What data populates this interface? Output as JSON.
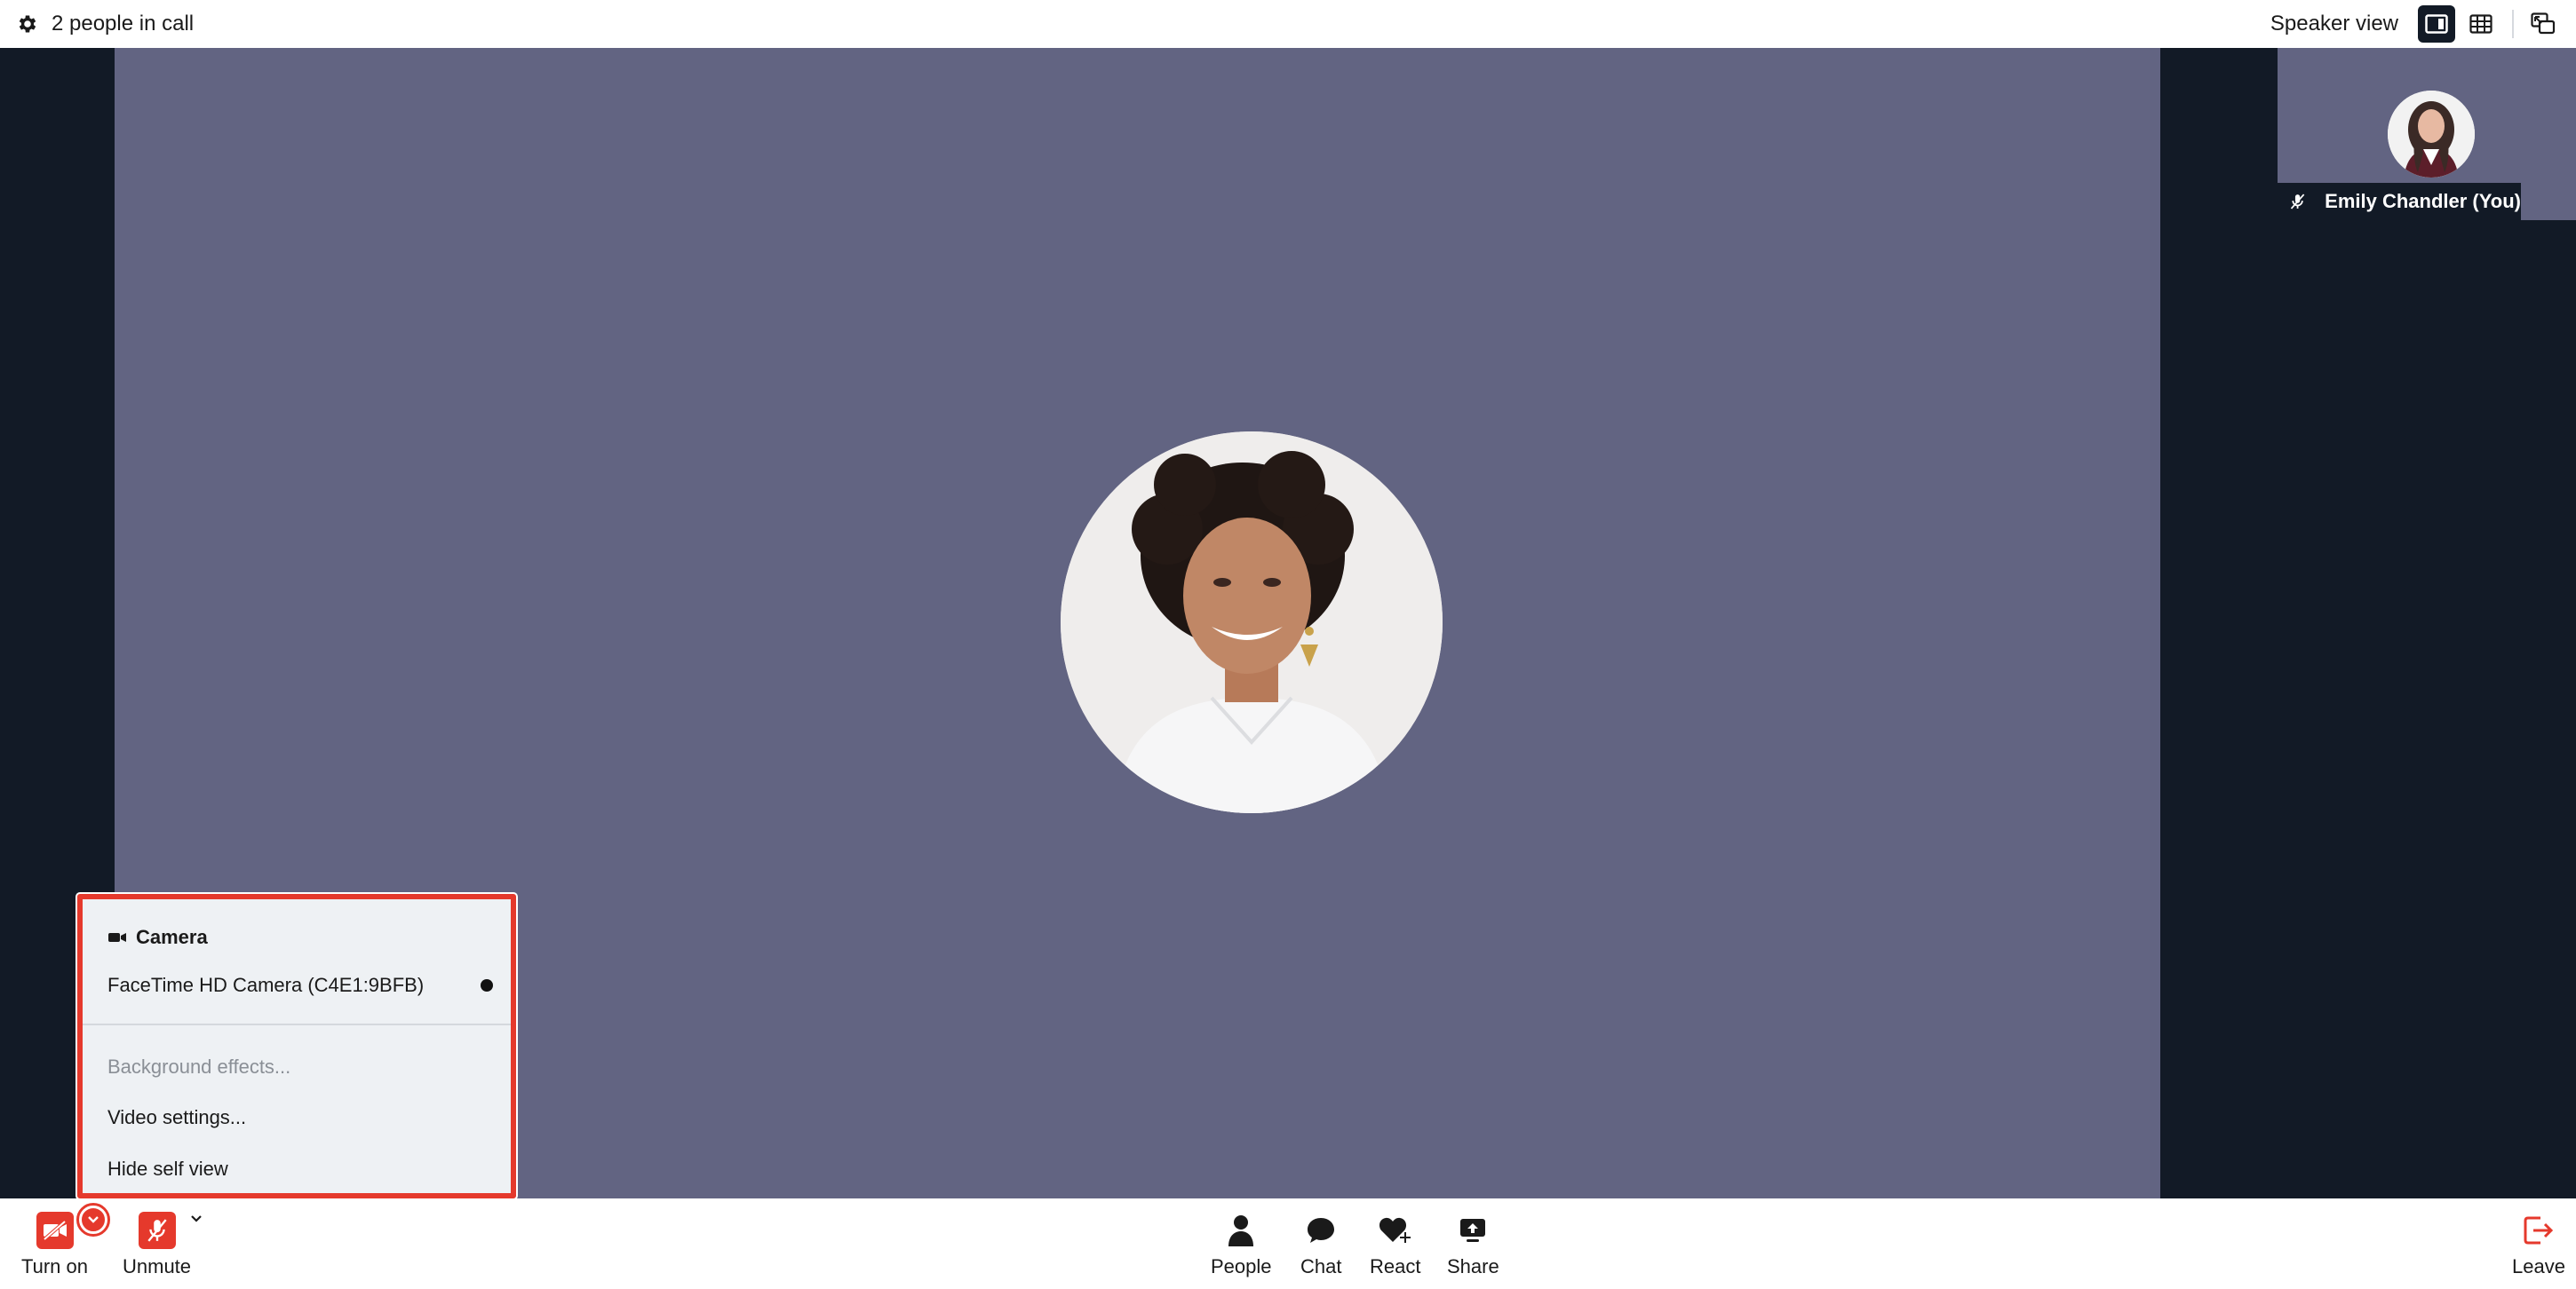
{
  "topbar": {
    "participants_text": "2 people in call",
    "view_label": "Speaker view",
    "icons": [
      "gear-icon",
      "speaker-view-icon",
      "grid-view-icon",
      "picture-in-picture-icon"
    ]
  },
  "self_tile": {
    "name": "Emily Chandler (You)",
    "muted_icon": "mic-off-icon"
  },
  "camera_menu": {
    "header": "Camera",
    "device": "FaceTime HD Camera (C4E1:9BFB)",
    "items": [
      {
        "label": "Background effects...",
        "disabled": true
      },
      {
        "label": "Video settings...",
        "disabled": false
      },
      {
        "label": "Hide self view",
        "disabled": false
      }
    ]
  },
  "toolbar": {
    "camera_label": "Turn on",
    "mic_label": "Unmute",
    "people_label": "People",
    "chat_label": "Chat",
    "react_label": "React",
    "share_label": "Share",
    "leave_label": "Leave"
  },
  "colors": {
    "accent_red": "#e5392c",
    "stage_bg": "#121a26",
    "video_bg": "#626482",
    "menu_bg": "#eef1f4"
  }
}
